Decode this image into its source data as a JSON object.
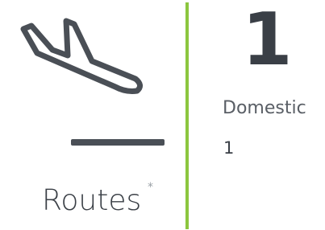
{
  "tile": {
    "icon": "plane-landing-icon",
    "title": "Routes",
    "marker": "*",
    "accent_color": "#8cc63f",
    "total": "1",
    "breakdown": {
      "label": "Domestic",
      "value": "1"
    }
  }
}
